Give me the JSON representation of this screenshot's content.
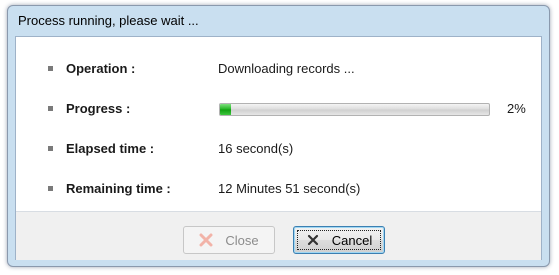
{
  "window": {
    "title": "Process running, please wait ..."
  },
  "rows": {
    "operation": {
      "label": "Operation :",
      "value": "Downloading records ..."
    },
    "progress": {
      "label": "Progress :",
      "percent_text": "2%",
      "fraction": 0.02
    },
    "elapsed": {
      "label": "Elapsed time :",
      "value": "16 second(s)"
    },
    "remaining": {
      "label": "Remaining time :",
      "value": "12 Minutes 51 second(s)"
    }
  },
  "buttons": {
    "close_label": "Close",
    "cancel_label": "Cancel"
  },
  "icons": {
    "close": "close-x-icon",
    "cancel": "cancel-x-icon",
    "bullet": "square-bullet-icon"
  },
  "colors": {
    "progress_fill": "#1fb21f",
    "close_icon_disabled": "#f2b3a8",
    "cancel_icon": "#333333",
    "title_bar": "#c9dff0"
  }
}
